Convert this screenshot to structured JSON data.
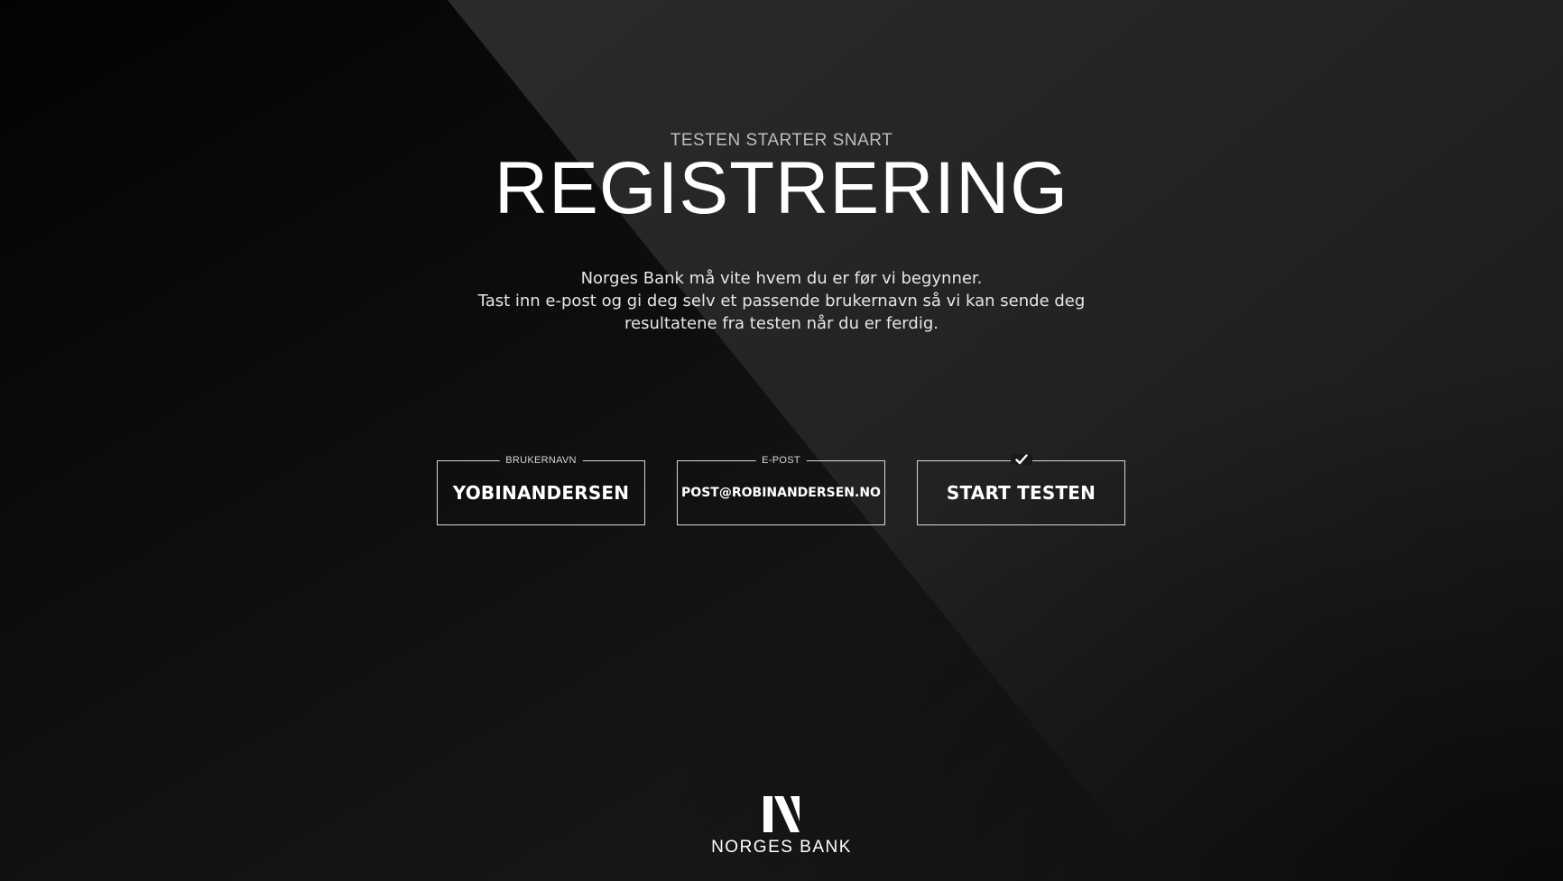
{
  "header": {
    "subtitle": "TESTEN STARTER SNART",
    "title": "REGISTRERING"
  },
  "description": {
    "line1": "Norges Bank må vite hvem du er før vi begynner.",
    "line2": "Tast inn e-post og gi deg selv et passende brukernavn så vi kan sende deg",
    "line3": "resultatene fra testen når du er ferdig."
  },
  "form": {
    "username": {
      "label": "BRUKERNAVN",
      "value": "YOBINANDERSEN"
    },
    "email": {
      "label": "E-POST",
      "value": "POST@ROBINANDERSEN.NO"
    },
    "start": {
      "label": "START TESTEN",
      "icon": "check-icon"
    }
  },
  "footer": {
    "logo_icon": "norges-bank-n-logo",
    "brand": "NORGES BANK"
  },
  "colors": {
    "background_dark": "#0b0b0b",
    "background_light": "#2a2a2a",
    "text": "#ffffff",
    "border": "#d8d8d8"
  }
}
